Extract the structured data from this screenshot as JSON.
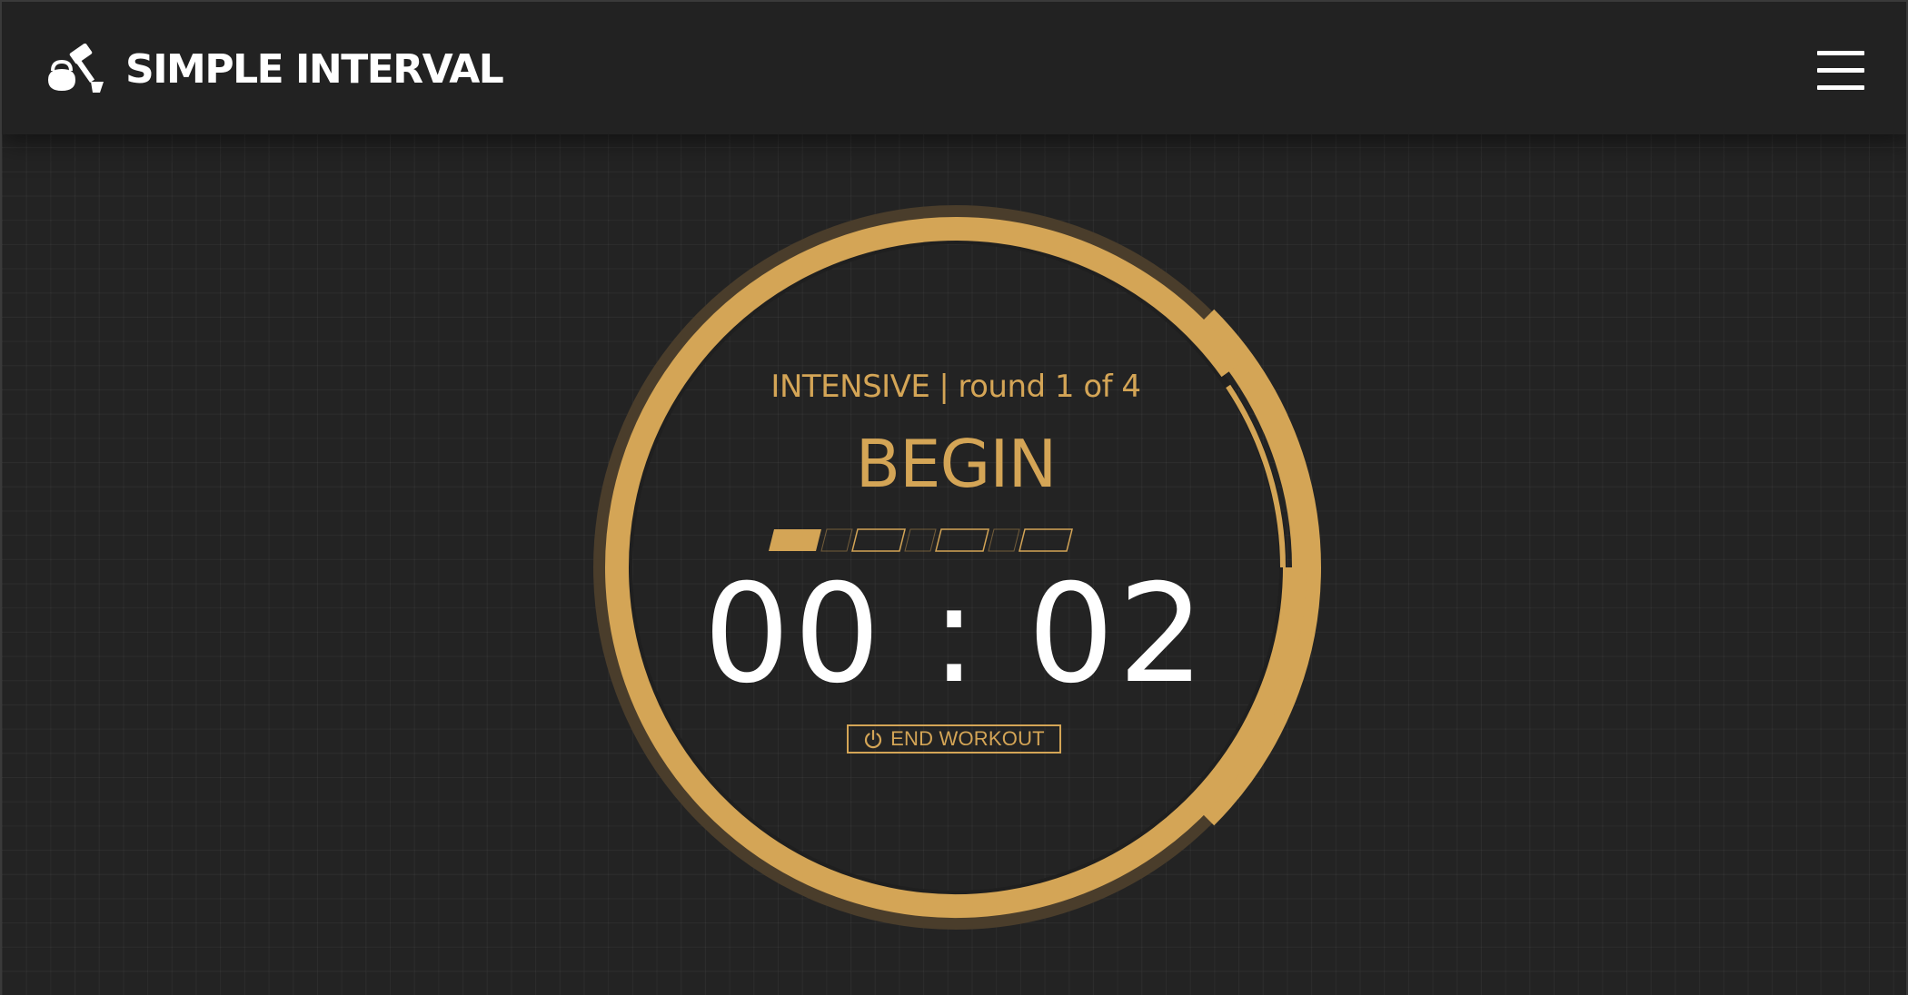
{
  "app": {
    "brand_name": "SIMPLE INTERVAL",
    "brand_icon": "kettlebell-hammer-icon",
    "menu_icon": "hamburger-menu-icon"
  },
  "workout": {
    "program": "INTENSIVE",
    "separator": "|",
    "round_text": "round 1 of 4",
    "phase": "BEGIN",
    "time_display": "00 : 02",
    "end_button_label": "END WORKOUT",
    "end_button_icon": "power-icon",
    "segments": [
      {
        "state": "filled"
      },
      {
        "state": "empty"
      },
      {
        "state": "empty"
      },
      {
        "state": "empty"
      },
      {
        "state": "empty"
      },
      {
        "state": "empty"
      },
      {
        "state": "empty"
      }
    ],
    "inner_ring_progress": 0.11,
    "outer_ring_progress": 0.25
  },
  "colors": {
    "accent": "#d4a556",
    "accent_dim": "#4a3d2b",
    "background": "#232323",
    "navbar": "#222222",
    "text": "#ffffff"
  }
}
